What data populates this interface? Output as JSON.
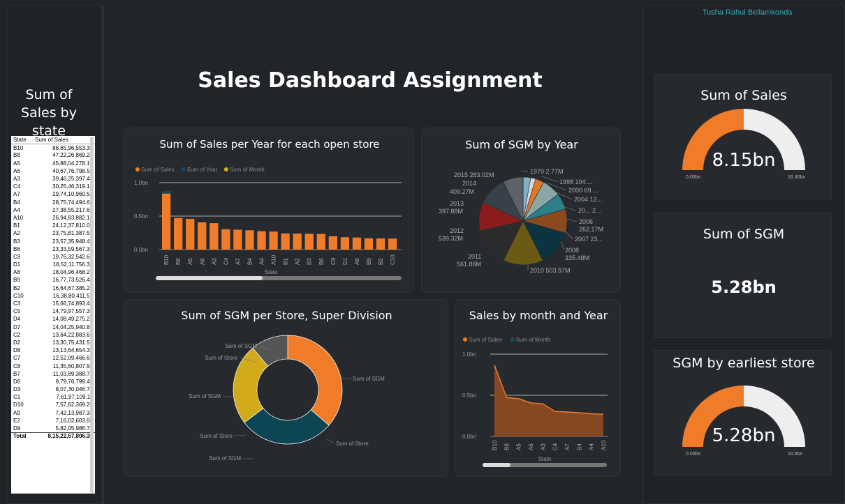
{
  "author": "Tusha Rahul Bellamkonda",
  "dashboard_title": "Sales Dashboard Assignment",
  "state_table": {
    "title": "Sum of Sales by state",
    "columns": [
      "State",
      "Sum of Sales"
    ],
    "rows": [
      [
        "B10",
        "86,65,96,553.30"
      ],
      [
        "B8",
        "47,22,26,869.20"
      ],
      [
        "A5",
        "45,88,04,278.10"
      ],
      [
        "A6",
        "40,67,76,798.53"
      ],
      [
        "A3",
        "39,46,25,397.44"
      ],
      [
        "C4",
        "30,25,46,319.18"
      ],
      [
        "A7",
        "29,74,10,960.58"
      ],
      [
        "B4",
        "28,75,74,494.69"
      ],
      [
        "A4",
        "27,38,55,217.61"
      ],
      [
        "A10",
        "26,94,83,882.14"
      ],
      [
        "B1",
        "24,12,37,810.07"
      ],
      [
        "A2",
        "23,75,81,387.59"
      ],
      [
        "B3",
        "23,57,35,948.47"
      ],
      [
        "B6",
        "23,33,59,567.31"
      ],
      [
        "C9",
        "19,76,32,542.68"
      ],
      [
        "D1",
        "18,52,11,756.35"
      ],
      [
        "A8",
        "18,04,96,468.27"
      ],
      [
        "B9",
        "16,77,73,526.43"
      ],
      [
        "B2",
        "16,64,67,385.25"
      ],
      [
        "C10",
        "16,38,80,411.57"
      ],
      [
        "C3",
        "15,66,74,893.46"
      ],
      [
        "C5",
        "14,79,97,557.39"
      ],
      [
        "D4",
        "14,08,49,275.26"
      ],
      [
        "D7",
        "14,04,25,940.87"
      ],
      [
        "C2",
        "13,64,22,883.67"
      ],
      [
        "D2",
        "13,30,75,431.51"
      ],
      [
        "D8",
        "13,13,64,654.38"
      ],
      [
        "C7",
        "12,52,09,466.62"
      ],
      [
        "C8",
        "11,35,60,807.98"
      ],
      [
        "B7",
        "11,03,89,388.72"
      ],
      [
        "D6",
        "9,79,76,799.49"
      ],
      [
        "D3",
        "8,07,30,046.73"
      ],
      [
        "C1",
        "7,61,97,109.11"
      ],
      [
        "D10",
        "7,57,62,369.20"
      ],
      [
        "A9",
        "7,42,13,987.34"
      ],
      [
        "E2",
        "7,16,02,603.04"
      ],
      [
        "D9",
        "5,82,05,986.79"
      ]
    ],
    "total_label": "Total",
    "total_value": "8,15,22,57,806.36"
  },
  "bar_chart": {
    "title": "Sum of Sales per Year for each open store",
    "legend": [
      "Sum of Sales",
      "Sum of Year",
      "Sum of Month"
    ],
    "legend_colors": [
      "#f07c2a",
      "#12505e",
      "#d4b21c"
    ],
    "y_ticks": [
      "1.0bn",
      "0.5bn",
      "0.0bn"
    ],
    "xlabel": "State"
  },
  "pie_chart": {
    "title": "Sum of SGM by Year",
    "labels": {
      "l2015": "2015 283.02M",
      "l2014a": "2014",
      "l2014b": "409.27M",
      "l2013a": "2013",
      "l2013b": "397.88M",
      "l2012a": "2012",
      "l2012b": "539.32M",
      "l2011a": "2011",
      "l2011b": "561.86M",
      "l1979": "1979 2.77M",
      "l1998": "1998 104....",
      "l2000": "2000 69....",
      "l2004": "2004 12...",
      "l20x": "20... 2...",
      "l2006a": "2006",
      "l2006b": "262.17M",
      "l2007": "2007 23...",
      "l2008a": "2008",
      "l2008b": "335.48M",
      "l2010": "2010 503.97M"
    }
  },
  "donut_chart": {
    "title": "Sum of SGM per Store, Super Division",
    "labels": {
      "a": "Sum of SGM",
      "b": "Sum of Store",
      "c": "Sum of SGM",
      "d": "Sum of Store",
      "e": "Sum of SGM",
      "f": "Sum of Store",
      "g": "Sum of SGM"
    }
  },
  "area_chart": {
    "title": "Sales by month and Year",
    "legend": [
      "Sum of Sales",
      "Sum of Month"
    ],
    "legend_colors": [
      "#f07c2a",
      "#12505e"
    ],
    "y_ticks": [
      "1.0bn",
      "0.5bn",
      "0.0bn"
    ],
    "xlabel": "State"
  },
  "kpis": {
    "sales_title": "Sum of Sales",
    "sales_value": "8.15bn",
    "sales_min": "0.00bn",
    "sales_max": "16.30bn",
    "sales_fill": 0.5,
    "sgm_title": "Sum of SGM",
    "sgm_value": "5.28bn",
    "early_title": "SGM by earliest store",
    "early_value": "5.28bn",
    "early_min": "0.00bn",
    "early_max": "10.5bn",
    "early_fill": 0.5
  },
  "chart_data": [
    {
      "type": "bar",
      "title": "Sum of Sales per Year for each open store",
      "xlabel": "State",
      "ylabel": "",
      "ylim": [
        0,
        1.0
      ],
      "categories": [
        "B10",
        "B8",
        "A5",
        "A6",
        "A3",
        "C4",
        "A7",
        "B4",
        "A4",
        "A10",
        "B1",
        "A2",
        "B3",
        "B6",
        "C9",
        "D1",
        "A8",
        "B9",
        "B2",
        "C10"
      ],
      "series": [
        {
          "name": "Sum of Sales",
          "values": [
            0.867,
            0.472,
            0.459,
            0.407,
            0.395,
            0.303,
            0.297,
            0.288,
            0.274,
            0.269,
            0.241,
            0.238,
            0.236,
            0.233,
            0.198,
            0.185,
            0.18,
            0.168,
            0.166,
            0.164
          ]
        }
      ]
    },
    {
      "type": "pie",
      "title": "Sum of SGM by Year",
      "categories": [
        "2010",
        "2011",
        "2012",
        "2013",
        "2014",
        "2015",
        "1979",
        "1998",
        "2000",
        "2004",
        "2006",
        "2007",
        "2008"
      ],
      "values": [
        503.97,
        561.86,
        539.32,
        397.88,
        409.27,
        283.02,
        2.77,
        104,
        69,
        120,
        262.17,
        230,
        335.48
      ]
    },
    {
      "type": "pie",
      "title": "Sum of SGM per Store, Super Division",
      "categories": [
        "Sum of SGM",
        "Sum of Store",
        "Sum of SGM",
        "Sum of Store"
      ],
      "values": [
        36,
        28,
        24,
        11
      ]
    },
    {
      "type": "area",
      "title": "Sales by month and Year",
      "xlabel": "State",
      "ylim": [
        0,
        1.0
      ],
      "categories": [
        "B10",
        "B8",
        "A5",
        "A6",
        "A3",
        "C4",
        "A7",
        "B4",
        "A4",
        "A10"
      ],
      "series": [
        {
          "name": "Sum of Sales",
          "values": [
            0.867,
            0.472,
            0.459,
            0.407,
            0.395,
            0.303,
            0.297,
            0.288,
            0.274,
            0.269
          ]
        }
      ]
    }
  ]
}
